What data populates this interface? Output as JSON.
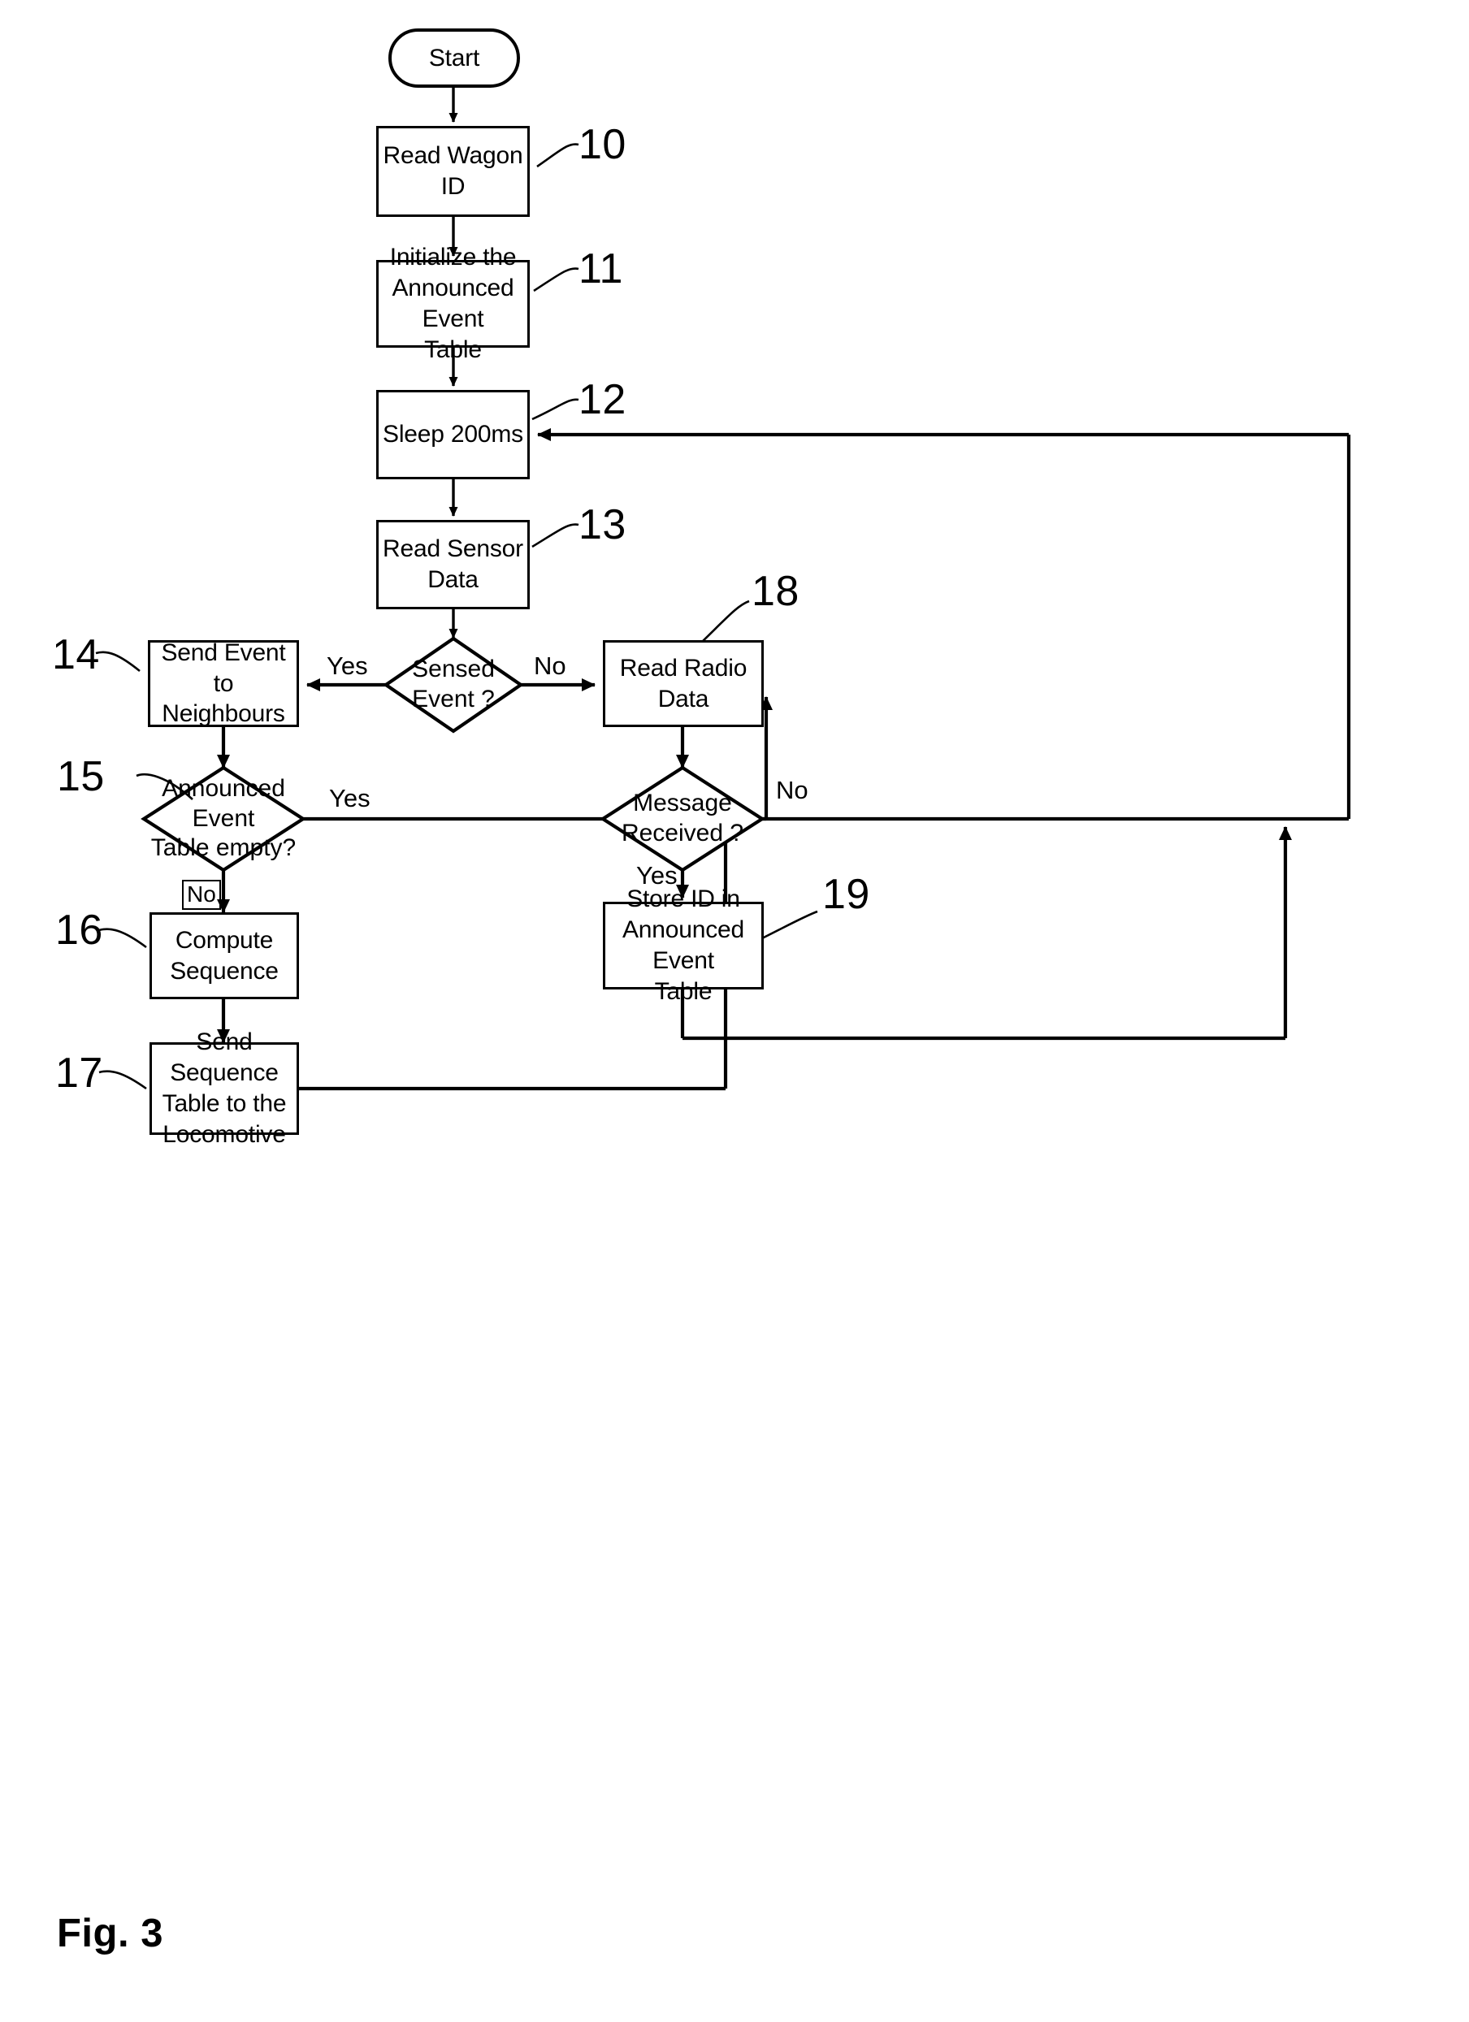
{
  "figure": {
    "caption": "Fig. 3",
    "start_label": "Start"
  },
  "nodes": {
    "n10": {
      "ref": "10",
      "text": "Read Wagon ID"
    },
    "n11": {
      "ref": "11",
      "text": "Initialize the\nAnnounced Event\nTable"
    },
    "n12": {
      "ref": "12",
      "text": "Sleep 200ms"
    },
    "n13": {
      "ref": "13",
      "text": "Read Sensor Data"
    },
    "n14": {
      "ref": "14",
      "text": "Send Event to\nNeighbours"
    },
    "n15": {
      "ref": "15",
      "text": "Announced Event\nTable empty?"
    },
    "n16": {
      "ref": "16",
      "text": "Compute\nSequence"
    },
    "n17": {
      "ref": "17",
      "text": "Send Sequence\nTable to the\nLocomotive"
    },
    "n18": {
      "ref": "18",
      "text": "Read Radio Data"
    },
    "n19": {
      "ref": "19",
      "text": "Store ID in\nAnnounced Event\nTable"
    },
    "d_sensed": {
      "text": "Sensed\nEvent ?"
    },
    "d_message": {
      "text": "Message\nReceived ?"
    }
  },
  "edge_labels": {
    "sensed_yes": "Yes",
    "sensed_no": "No",
    "table_empty_yes": "Yes",
    "table_empty_no": "No",
    "message_no": "No",
    "message_yes": "Yes"
  },
  "colors": {
    "stroke": "#000000",
    "background": "#ffffff"
  }
}
